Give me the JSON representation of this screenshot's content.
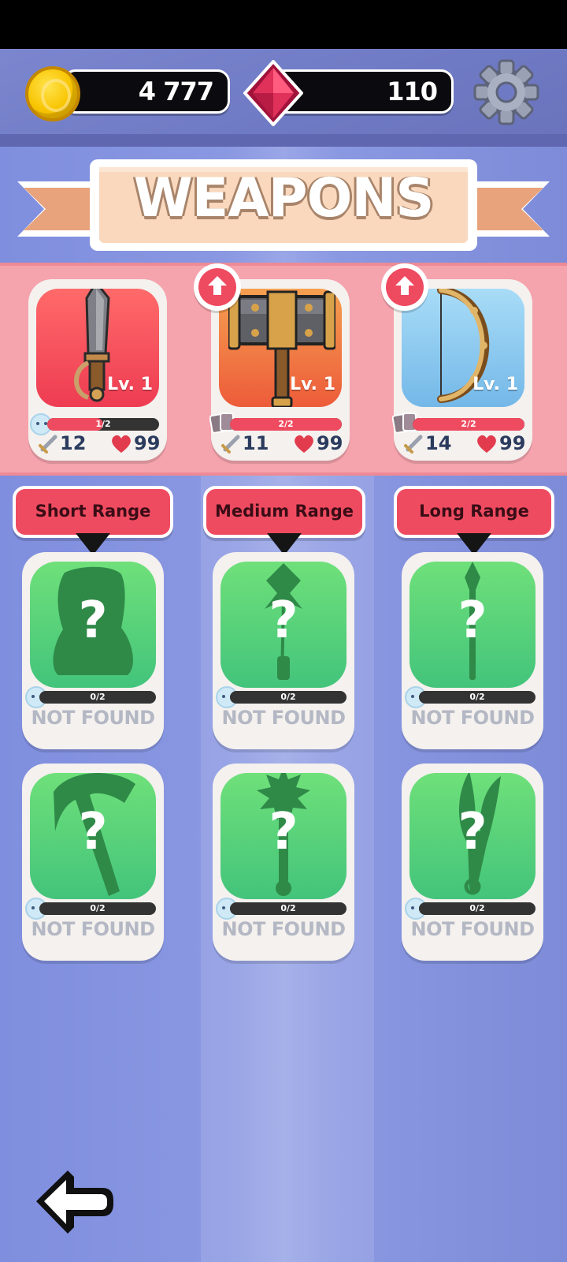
{
  "currency": {
    "coins": "4 777",
    "gems": "110"
  },
  "header": {
    "title": "WEAPONS"
  },
  "equipped": [
    {
      "level": "Lv. 1",
      "progress": "1/2",
      "progress_fraction": 0.5,
      "attack": "12",
      "health": "99",
      "upgrade_available": false,
      "color": "#ef4b5a"
    },
    {
      "level": "Lv. 1",
      "progress": "2/2",
      "progress_fraction": 1.0,
      "attack": "11",
      "health": "99",
      "upgrade_available": true,
      "color": "#f07d3a"
    },
    {
      "level": "Lv. 1",
      "progress": "2/2",
      "progress_fraction": 1.0,
      "attack": "14",
      "health": "99",
      "upgrade_available": true,
      "color": "#8cc8ee"
    }
  ],
  "ranges": [
    "Short Range",
    "Medium Range",
    "Long Range"
  ],
  "locked": [
    {
      "progress": "0/2",
      "status": "NOT FOUND",
      "icon": "bag-silhouette-icon"
    },
    {
      "progress": "0/2",
      "status": "NOT FOUND",
      "icon": "axe-staff-silhouette-icon"
    },
    {
      "progress": "0/2",
      "status": "NOT FOUND",
      "icon": "spear-silhouette-icon"
    },
    {
      "progress": "0/2",
      "status": "NOT FOUND",
      "icon": "hatchet-silhouette-icon"
    },
    {
      "progress": "0/2",
      "status": "NOT FOUND",
      "icon": "mace-silhouette-icon"
    },
    {
      "progress": "0/2",
      "status": "NOT FOUND",
      "icon": "kunai-silhouette-icon"
    }
  ],
  "colors": {
    "accent_red": "#ef4b60",
    "locked_green": "#43c47b",
    "background": "#7d8bd8"
  }
}
